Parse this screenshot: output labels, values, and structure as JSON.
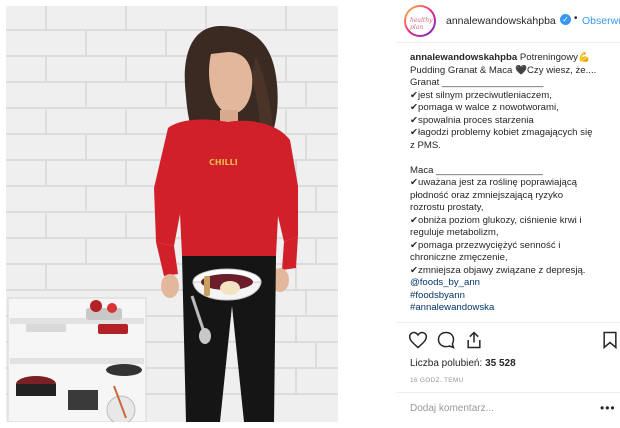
{
  "header": {
    "username": "annalewandowskahpba",
    "verified": true,
    "follow_label": "Obserwuj",
    "avatar_text": "healthy plan"
  },
  "caption": {
    "lines": [
      {
        "author": "annalewandowskahpba",
        "text": " Potreningowy💪"
      },
      {
        "text": "Pudding Granat & Maca 🖤Czy wiesz, że...."
      },
      {
        "text": "Granat ___________________"
      },
      {
        "text": "✔jest silnym przeciwutleniaczem,"
      },
      {
        "text": "✔pomaga w walce z nowotworami,"
      },
      {
        "text": "✔spowalnia proces starzenia"
      },
      {
        "text": "✔łagodzi problemy kobiet zmagających się"
      },
      {
        "text": "z PMS."
      },
      {
        "text": ""
      },
      {
        "text": "Maca ____________________"
      },
      {
        "text": "✔uważana jest za roślinę poprawiającą"
      },
      {
        "text": "płodność oraz zmniejszającą ryzyko"
      },
      {
        "text": "rozrostu prostaty,"
      },
      {
        "text": "✔obniża poziom glukozy, ciśnienie krwi i"
      },
      {
        "text": "reguluje metabolizm,"
      },
      {
        "text": "✔pomaga przezwyciężyć senność i"
      },
      {
        "text": "chroniczne zmęczenie,"
      },
      {
        "text": "✔zmniejsza objawy związane z depresją."
      },
      {
        "text": "@foods_by_ann",
        "tag": true
      },
      {
        "text": "#foodsbyann",
        "tag": true
      },
      {
        "text": "#annalewandowska",
        "tag": true
      }
    ]
  },
  "actions": {
    "like_icon": "heart-icon",
    "comment_icon": "comment-icon",
    "share_icon": "share-icon",
    "save_icon": "bookmark-icon"
  },
  "likes": {
    "label": "Liczba polubień:",
    "count": "35 528"
  },
  "timestamp": "16 GODZ. TEMU",
  "comment": {
    "placeholder": "Dodaj komentarz..."
  },
  "more_label": "•••",
  "photo": {
    "shirt_text": "CHILLI"
  },
  "colors": {
    "accent": "#3897f0",
    "tag": "#003569",
    "shirt": "#d2202b"
  }
}
